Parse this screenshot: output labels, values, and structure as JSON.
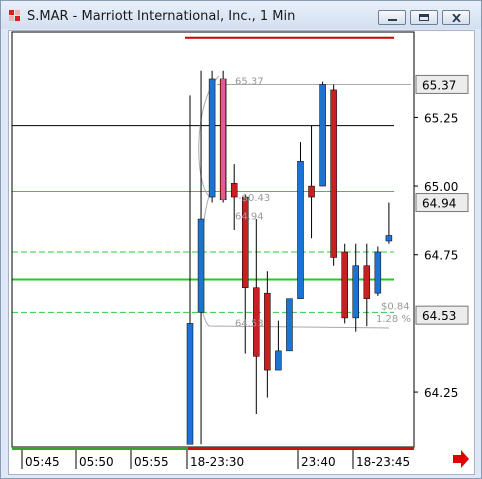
{
  "window": {
    "title": "S.MAR - Marriott International, Inc., 1 Min",
    "buttons": [
      "minimize",
      "restore",
      "close"
    ]
  },
  "chart_data": {
    "type": "candlestick",
    "symbol": "S.MAR",
    "timeframe": "1 Min",
    "y_axis": {
      "ylim": [
        64.05,
        65.55
      ],
      "tick_labels": [
        "65.25",
        "65.00",
        "64.75",
        "64.25"
      ],
      "ticks": [
        65.25,
        65.0,
        64.75,
        64.25
      ],
      "price_boxes": [
        {
          "label": "65.37",
          "value": 65.37
        },
        {
          "label": "64.94",
          "value": 64.94
        },
        {
          "label": "64.53",
          "value": 64.53
        }
      ]
    },
    "x_axis": {
      "tick_labels": [
        "05:45",
        "05:50",
        "05:55",
        "18-23:30",
        "23:40",
        "18-23:45"
      ]
    },
    "candles": [
      {
        "open": 64.06,
        "high": 65.33,
        "low": 64.06,
        "close": 64.5,
        "color": "blue"
      },
      {
        "open": 64.54,
        "high": 65.42,
        "low": 64.06,
        "close": 64.88,
        "color": "blue"
      },
      {
        "open": 64.96,
        "high": 65.42,
        "low": 64.94,
        "close": 65.39,
        "color": "blue"
      },
      {
        "open": 65.39,
        "high": 65.42,
        "low": 64.94,
        "close": 64.95,
        "color": "red"
      },
      {
        "open": 65.01,
        "high": 65.08,
        "low": 64.84,
        "close": 64.96,
        "color": "red"
      },
      {
        "open": 64.96,
        "high": 64.97,
        "low": 64.39,
        "close": 64.63,
        "color": "red"
      },
      {
        "open": 64.63,
        "high": 64.88,
        "low": 64.17,
        "close": 64.38,
        "color": "red"
      },
      {
        "open": 64.61,
        "high": 64.69,
        "low": 64.23,
        "close": 64.33,
        "color": "red"
      },
      {
        "open": 64.33,
        "high": 64.51,
        "low": 64.33,
        "close": 64.4,
        "color": "blue"
      },
      {
        "open": 64.4,
        "high": 64.51,
        "low": 64.4,
        "close": 64.59,
        "color": "blue"
      },
      {
        "open": 64.59,
        "high": 65.16,
        "low": 64.59,
        "close": 65.09,
        "color": "blue"
      },
      {
        "open": 64.96,
        "high": 65.22,
        "low": 64.81,
        "close": 65.0,
        "color": "red"
      },
      {
        "open": 65.0,
        "high": 65.38,
        "low": 65.0,
        "close": 65.37,
        "color": "blue"
      },
      {
        "open": 65.35,
        "high": 65.37,
        "low": 64.71,
        "close": 64.74,
        "color": "red"
      },
      {
        "open": 64.76,
        "high": 64.79,
        "low": 64.5,
        "close": 64.52,
        "color": "red"
      },
      {
        "open": 64.52,
        "high": 64.79,
        "low": 64.47,
        "close": 64.71,
        "color": "blue"
      },
      {
        "open": 64.71,
        "high": 64.79,
        "low": 64.49,
        "close": 64.59,
        "color": "red"
      },
      {
        "open": 64.61,
        "high": 64.78,
        "low": 64.6,
        "close": 64.76,
        "color": "blue"
      },
      {
        "open": 64.8,
        "high": 64.94,
        "low": 64.79,
        "close": 64.82,
        "color": "blue"
      }
    ],
    "horizontal_lines": [
      {
        "value": 65.54,
        "color": "#cc0000",
        "style": "solid"
      },
      {
        "value": 65.22,
        "color": "#000000",
        "style": "solid"
      },
      {
        "value": 64.98,
        "color": "#2ecc40",
        "style": "solid"
      },
      {
        "value": 64.76,
        "color": "#2ecc40",
        "style": "dashed"
      },
      {
        "value": 64.66,
        "color": "#1fcc1f",
        "style": "solid"
      },
      {
        "value": 64.54,
        "color": "#2ecc40",
        "style": "dashed"
      }
    ],
    "annotations": [
      {
        "text": "65.37",
        "value": 65.37
      },
      {
        "text": "-$0.43",
        "value": 64.96
      },
      {
        "text": "64.94",
        "value": 64.9
      },
      {
        "text": "$0.84",
        "value": 64.55
      },
      {
        "text": "1.28 %",
        "value": 64.52
      },
      {
        "text": "64.53",
        "value": 64.51
      }
    ],
    "colors": {
      "up": "#1e73d2",
      "down": "#c62020",
      "time_bar_green": "#2fa82f",
      "time_bar_red": "#cc1111",
      "arrow": "#e00000"
    }
  }
}
